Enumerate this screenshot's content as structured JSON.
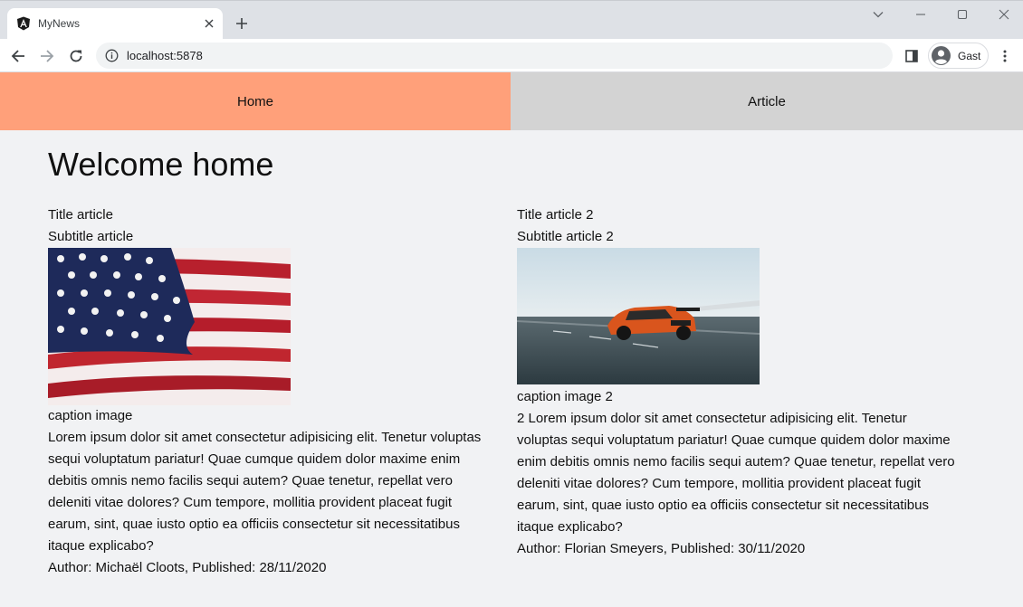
{
  "browser": {
    "tab": {
      "title": "MyNews"
    },
    "address": {
      "url": "localhost:5878"
    },
    "profile": {
      "name": "Gast"
    }
  },
  "nav": {
    "home_label": "Home",
    "article_label": "Article",
    "colors": {
      "home_bg": "#ffa07a",
      "article_bg": "#d3d3d3"
    }
  },
  "page": {
    "title": "Welcome home"
  },
  "articles": [
    {
      "title": "Title article",
      "subtitle": "Subtitle article",
      "image": "us-flag",
      "caption": "caption image",
      "body": "Lorem ipsum dolor sit amet consectetur adipisicing elit. Tenetur voluptas sequi voluptatum pariatur! Quae cumque quidem dolor maxime enim debitis omnis nemo facilis sequi autem? Quae tenetur, repellat vero deleniti vitae dolores? Cum tempore, mollitia provident placeat fugit earum, sint, quae iusto optio ea officiis consectetur sit necessitatibus itaque explicabo?",
      "byline": "Author: Michaël Cloots, Published: 28/11/2020"
    },
    {
      "title": "Title article 2",
      "subtitle": "Subtitle article 2",
      "image": "orange-sports-car",
      "caption": "caption image 2",
      "body": "2 Lorem ipsum dolor sit amet consectetur adipisicing elit. Tenetur voluptas sequi voluptatum pariatur! Quae cumque quidem dolor maxime enim debitis omnis nemo facilis sequi autem? Quae tenetur, repellat vero deleniti vitae dolores? Cum tempore, mollitia provident placeat fugit earum, sint, quae iusto optio ea officiis consectetur sit necessitatibus itaque explicabo?",
      "byline": "Author: Florian Smeyers, Published: 30/11/2020"
    }
  ]
}
